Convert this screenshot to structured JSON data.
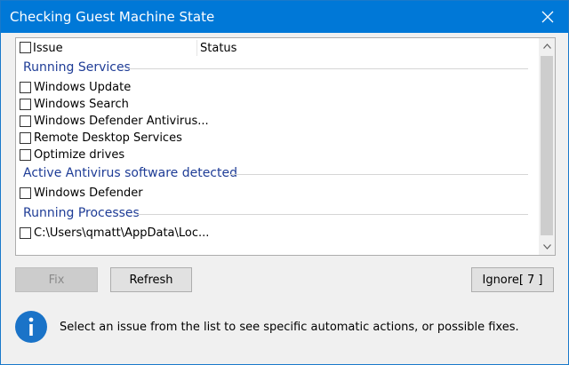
{
  "window": {
    "title": "Checking Guest Machine State"
  },
  "list": {
    "columns": {
      "issue": "Issue",
      "status": "Status"
    },
    "groups": [
      {
        "label": "Running Services",
        "items": [
          "Windows Update",
          "Windows Search",
          "Windows Defender Antivirus...",
          "Remote Desktop Services",
          "Optimize drives"
        ]
      },
      {
        "label": "Active Antivirus software detected",
        "items": [
          "Windows Defender"
        ]
      },
      {
        "label": "Running Processes",
        "items": [
          "C:\\Users\\qmatt\\AppData\\Loc..."
        ]
      }
    ]
  },
  "buttons": {
    "fix": "Fix",
    "refresh": "Refresh",
    "ignore": "Ignore[ 7 ]"
  },
  "info": {
    "text": "Select an issue from the list to see specific automatic actions, or possible fixes.",
    "icon": "info-icon"
  },
  "colors": {
    "titlebar": "#0078d7",
    "group_text": "#1e3c96",
    "info_icon": "#1a73c8"
  }
}
